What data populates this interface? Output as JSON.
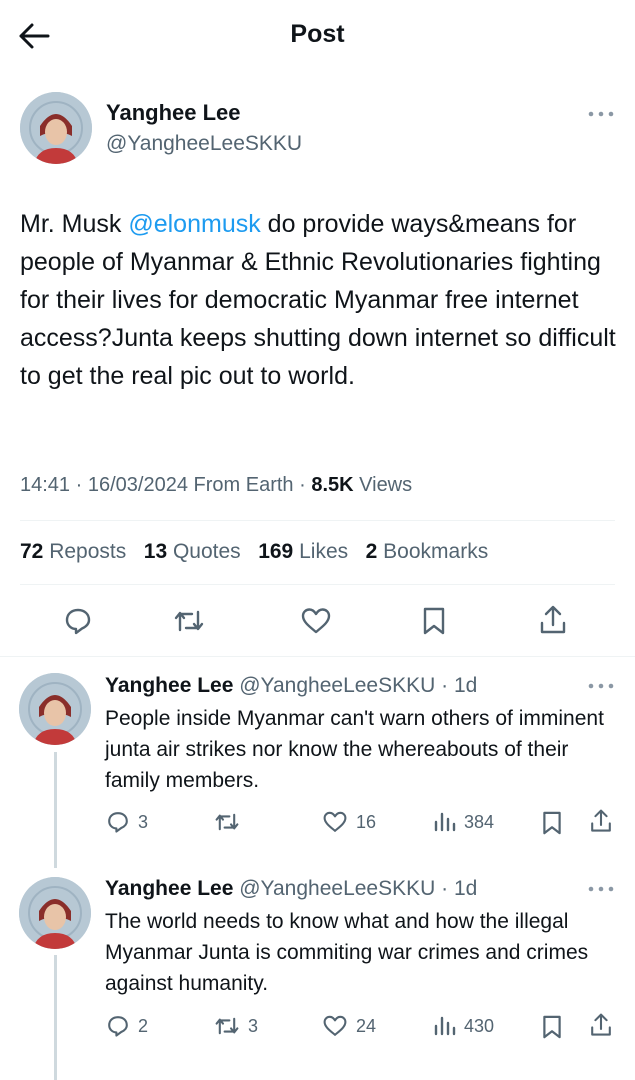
{
  "header": {
    "title": "Post"
  },
  "colors": {
    "link": "#1d9bf0",
    "muted": "#536471",
    "text": "#0f1419"
  },
  "post": {
    "author_name": "Yanghee Lee",
    "handle": "@YangheeLeeSKKU",
    "text_before_mention": "Mr. Musk ",
    "mention": "@elonmusk",
    "text_after_mention": " do provide ways&means for people of Myanmar & Ethnic Revolutionaries fighting for their lives for  democratic Myanmar free internet access?Junta keeps shutting down internet so difficult to get the real pic out to world.",
    "time": "14:41",
    "date": "16/03/2024",
    "source": "From Earth",
    "views_count": "8.5K",
    "views_label": "Views",
    "stats": {
      "reposts_count": "72",
      "reposts_label": "Reposts",
      "quotes_count": "13",
      "quotes_label": "Quotes",
      "likes_count": "169",
      "likes_label": "Likes",
      "bookmarks_count": "2",
      "bookmarks_label": "Bookmarks"
    }
  },
  "replies": [
    {
      "author_name": "Yanghee Lee",
      "handle": "@YangheeLeeSKKU",
      "age": "1d",
      "text": "People inside Myanmar can't warn others of imminent junta air strikes nor know the whereabouts of their family members.",
      "replies": "3",
      "reposts": "",
      "likes": "16",
      "views": "384"
    },
    {
      "author_name": "Yanghee Lee",
      "handle": "@YangheeLeeSKKU",
      "age": "1d",
      "text": "The world needs to know what and how the illegal Myanmar Junta is commiting war crimes and crimes against humanity.",
      "replies": "2",
      "reposts": "3",
      "likes": "24",
      "views": "430"
    }
  ]
}
